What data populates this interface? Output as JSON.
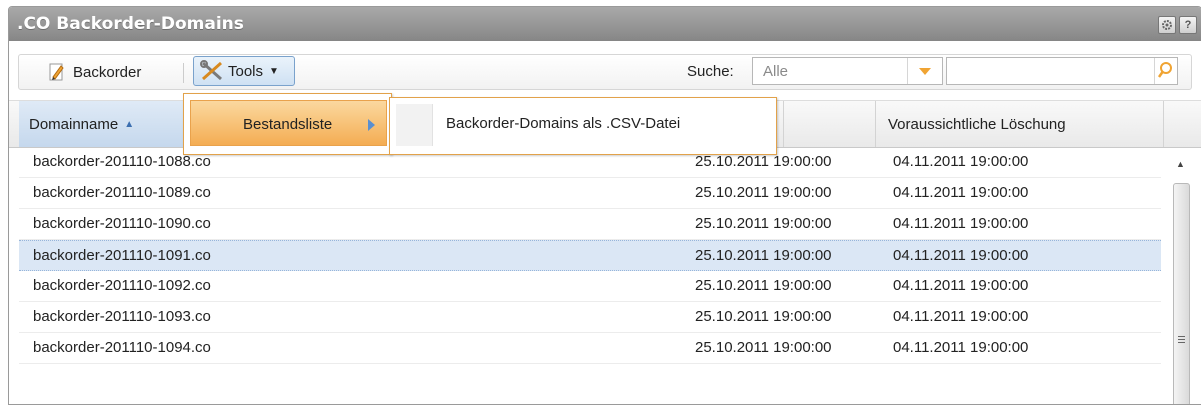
{
  "window": {
    "title": ".CO Backorder-Domains",
    "settings_icon": "gear-icon",
    "help_label": "?"
  },
  "toolbar": {
    "backorder_label": "Backorder",
    "tools_label": "Tools",
    "search_label": "Suche:",
    "search_select_value": "Alle",
    "search_value": ""
  },
  "grid": {
    "columns": [
      "Domainname",
      "",
      "Voraussichtliche Löschung"
    ],
    "sort_column": "Domainname",
    "sort_direction": "ascending",
    "rows": [
      {
        "domain": "backorder-201110-1088.co",
        "date1": "25.10.2011 19:00:00",
        "date2": "04.11.2011 19:00:00"
      },
      {
        "domain": "backorder-201110-1089.co",
        "date1": "25.10.2011 19:00:00",
        "date2": "04.11.2011 19:00:00"
      },
      {
        "domain": "backorder-201110-1090.co",
        "date1": "25.10.2011 19:00:00",
        "date2": "04.11.2011 19:00:00"
      },
      {
        "domain": "backorder-201110-1091.co",
        "date1": "25.10.2011 19:00:00",
        "date2": "04.11.2011 19:00:00",
        "selected": true
      },
      {
        "domain": "backorder-201110-1092.co",
        "date1": "25.10.2011 19:00:00",
        "date2": "04.11.2011 19:00:00"
      },
      {
        "domain": "backorder-201110-1093.co",
        "date1": "25.10.2011 19:00:00",
        "date2": "04.11.2011 19:00:00"
      },
      {
        "domain": "backorder-201110-1094.co",
        "date1": "25.10.2011 19:00:00",
        "date2": "04.11.2011 19:00:00"
      }
    ]
  },
  "menu": {
    "level1": "Bestandsliste",
    "level2": "Backorder-Domains als .CSV-Datei"
  },
  "colors": {
    "accent_orange": "#f4ad53",
    "selection": "#dbe7f5",
    "header_blue": "#c5d8ed"
  }
}
